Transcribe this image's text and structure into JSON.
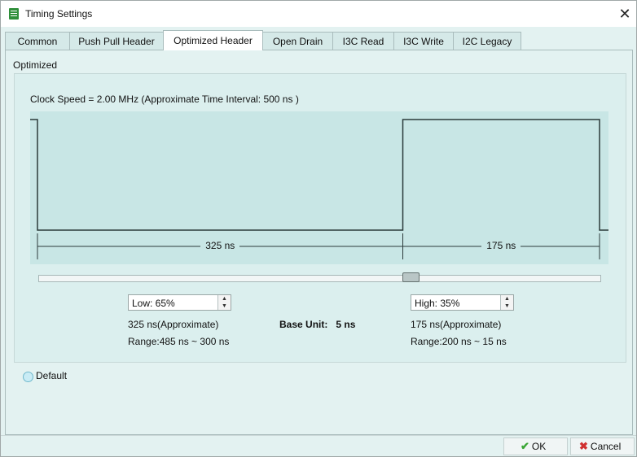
{
  "window": {
    "title": "Timing Settings",
    "icon": "document-icon",
    "close_glyph": "✕"
  },
  "tabs": [
    {
      "label": "Common",
      "active": false
    },
    {
      "label": "Push Pull Header",
      "active": false
    },
    {
      "label": "Optimized Header",
      "active": true
    },
    {
      "label": "Open Drain",
      "active": false
    },
    {
      "label": "I3C Read",
      "active": false
    },
    {
      "label": "I3C Write",
      "active": false
    },
    {
      "label": "I2C Legacy",
      "active": false
    }
  ],
  "panel": {
    "group_label": "Optimized",
    "clock_text": "Clock Speed = 2.00 MHz  (Approximate Time Interval: 500 ns )",
    "waveform": {
      "low_label": "325 ns",
      "high_label": "175 ns",
      "low_percent": 65,
      "high_percent": 35,
      "colors": {
        "line": "#2b3a3a",
        "background": "#c8e6e5"
      }
    },
    "slider": {
      "value_percent": 65
    },
    "low": {
      "spin_value": "Low: 65%",
      "approx": "325 ns(Approximate)",
      "range": "Range:485 ns ~ 300 ns"
    },
    "high": {
      "spin_value": "High: 35%",
      "approx": "175 ns(Approximate)",
      "range": "Range:200 ns ~  15 ns"
    },
    "base_unit": {
      "label": "Base Unit:",
      "value": "5 ns"
    },
    "default_radio": {
      "label": "Default",
      "checked": false
    }
  },
  "footer": {
    "ok": {
      "icon": "check-icon",
      "glyph": "✔",
      "label": "OK",
      "color": "#3aa635"
    },
    "cancel": {
      "icon": "cross-icon",
      "glyph": "✖",
      "label": "Cancel",
      "color": "#d03030"
    }
  }
}
